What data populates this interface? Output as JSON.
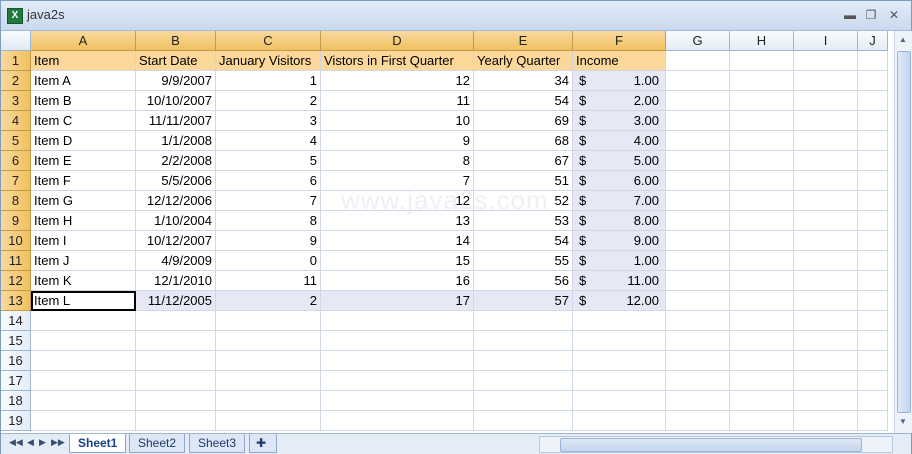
{
  "window": {
    "title": "java2s",
    "minimize": "▬",
    "restore": "❐",
    "close": "✕"
  },
  "columns": [
    "A",
    "B",
    "C",
    "D",
    "E",
    "F",
    "G",
    "H",
    "I",
    "J"
  ],
  "rows": [
    "1",
    "2",
    "3",
    "4",
    "5",
    "6",
    "7",
    "8",
    "9",
    "10",
    "11",
    "12",
    "13",
    "14",
    "15",
    "16",
    "17",
    "18",
    "19"
  ],
  "headers": [
    "Item",
    "Start Date",
    "January Visitors",
    "Vistors in First Quarter",
    "Yearly Quarter",
    "Income"
  ],
  "data": [
    {
      "item": "Item A",
      "date": "9/9/2007",
      "jan": "1",
      "q1": "12",
      "yq": "34",
      "inc": "1.00"
    },
    {
      "item": "Item B",
      "date": "10/10/2007",
      "jan": "2",
      "q1": "11",
      "yq": "54",
      "inc": "2.00"
    },
    {
      "item": "Item C",
      "date": "11/11/2007",
      "jan": "3",
      "q1": "10",
      "yq": "69",
      "inc": "3.00"
    },
    {
      "item": "Item D",
      "date": "1/1/2008",
      "jan": "4",
      "q1": "9",
      "yq": "68",
      "inc": "4.00"
    },
    {
      "item": "Item E",
      "date": "2/2/2008",
      "jan": "5",
      "q1": "8",
      "yq": "67",
      "inc": "5.00"
    },
    {
      "item": "Item F",
      "date": "5/5/2006",
      "jan": "6",
      "q1": "7",
      "yq": "51",
      "inc": "6.00"
    },
    {
      "item": "Item G",
      "date": "12/12/2006",
      "jan": "7",
      "q1": "12",
      "yq": "52",
      "inc": "7.00"
    },
    {
      "item": "Item H",
      "date": "1/10/2004",
      "jan": "8",
      "q1": "13",
      "yq": "53",
      "inc": "8.00"
    },
    {
      "item": "Item I",
      "date": "10/12/2007",
      "jan": "9",
      "q1": "14",
      "yq": "54",
      "inc": "9.00"
    },
    {
      "item": "Item J",
      "date": "4/9/2009",
      "jan": "0",
      "q1": "15",
      "yq": "55",
      "inc": "1.00"
    },
    {
      "item": "Item K",
      "date": "12/1/2010",
      "jan": "11",
      "q1": "16",
      "yq": "56",
      "inc": "11.00"
    },
    {
      "item": "Item L",
      "date": "11/12/2005",
      "jan": "2",
      "q1": "17",
      "yq": "57",
      "inc": "12.00"
    }
  ],
  "currency_symbol": "$",
  "watermark": "www.java2s.com",
  "sheets": [
    "Sheet1",
    "Sheet2",
    "Sheet3"
  ],
  "active_sheet": "Sheet1",
  "colors": {
    "header_fill": "#fbd89a",
    "selection_fill": "#e6e9f5",
    "grid": "#d0d7e5"
  }
}
